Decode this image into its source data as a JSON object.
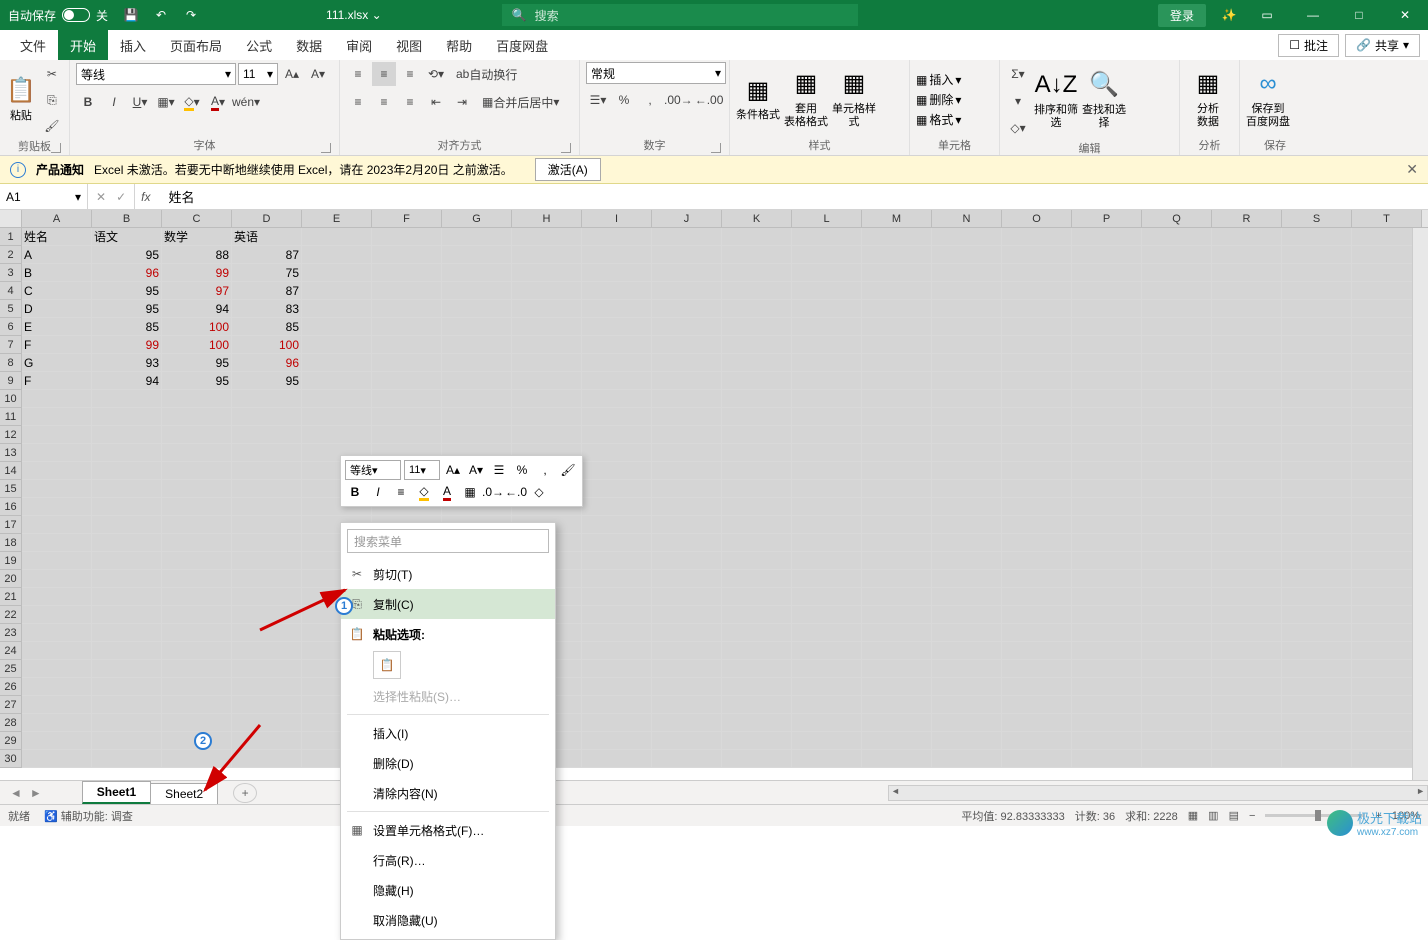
{
  "titlebar": {
    "autosave": "自动保存",
    "autosave_state": "关",
    "filename": "111.xlsx",
    "search_placeholder": "搜索",
    "login": "登录"
  },
  "tabs": {
    "items": [
      "文件",
      "开始",
      "插入",
      "页面布局",
      "公式",
      "数据",
      "审阅",
      "视图",
      "帮助",
      "百度网盘"
    ],
    "selected_index": 1,
    "comment": "批注",
    "share": "共享"
  },
  "ribbon": {
    "clipboard": {
      "label": "剪贴板",
      "paste": "粘贴"
    },
    "font": {
      "label": "字体",
      "name": "等线",
      "size": "11"
    },
    "align": {
      "label": "对齐方式",
      "wrap": "自动换行",
      "merge": "合并后居中"
    },
    "number": {
      "label": "数字",
      "format": "常规"
    },
    "styles": {
      "label": "样式",
      "cond": "条件格式",
      "table": "套用\n表格格式",
      "cell": "单元格样式"
    },
    "cells": {
      "label": "单元格",
      "insert": "插入",
      "delete": "删除",
      "format": "格式"
    },
    "editing": {
      "label": "编辑",
      "sort": "排序和筛选",
      "find": "查找和选择"
    },
    "analysis": {
      "label": "分析",
      "analyze": "分析\n数据"
    },
    "save": {
      "label": "保存",
      "baidu": "保存到\n百度网盘"
    }
  },
  "msgbar": {
    "title": "产品通知",
    "text": "Excel 未激活。若要无中断地继续使用 Excel，请在 2023年2月20日 之前激活。",
    "activate": "激活(A)"
  },
  "namebox": "A1",
  "formula": "姓名",
  "columns": [
    "A",
    "B",
    "C",
    "D",
    "E",
    "F",
    "G",
    "H",
    "I",
    "J",
    "K",
    "L",
    "M",
    "N",
    "O",
    "P",
    "Q",
    "R",
    "S",
    "T"
  ],
  "chart_data": {
    "type": "table",
    "headers": [
      "姓名",
      "语文",
      "数学",
      "英语"
    ],
    "rows": [
      {
        "name": "A",
        "yw": 95,
        "sx": 88,
        "yy": 87,
        "red": []
      },
      {
        "name": "B",
        "yw": 96,
        "sx": 99,
        "yy": 75,
        "red": [
          "yw",
          "sx"
        ]
      },
      {
        "name": "C",
        "yw": 95,
        "sx": 97,
        "yy": 87,
        "red": [
          "sx"
        ]
      },
      {
        "name": "D",
        "yw": 95,
        "sx": 94,
        "yy": 83,
        "red": []
      },
      {
        "name": "E",
        "yw": 85,
        "sx": 100,
        "yy": 85,
        "red": [
          "sx"
        ]
      },
      {
        "name": "F",
        "yw": 99,
        "sx": 100,
        "yy": 100,
        "red": [
          "yw",
          "sx",
          "yy"
        ]
      },
      {
        "name": "G",
        "yw": 93,
        "sx": 95,
        "yy": 96,
        "red": [
          "yy"
        ]
      },
      {
        "name": "F",
        "yw": 94,
        "sx": 95,
        "yy": 95,
        "red": []
      }
    ]
  },
  "mini": {
    "font": "等线",
    "size": "11"
  },
  "ctx": {
    "search": "搜索菜单",
    "cut": "剪切(T)",
    "copy": "复制(C)",
    "paste_opts": "粘贴选项:",
    "paste_special": "选择性粘贴(S)…",
    "insert": "插入(I)",
    "delete": "删除(D)",
    "clear": "清除内容(N)",
    "format_cells": "设置单元格格式(F)…",
    "row_height": "行高(R)…",
    "hide": "隐藏(H)",
    "unhide": "取消隐藏(U)"
  },
  "sheets": {
    "tabs": [
      "Sheet1",
      "Sheet2"
    ],
    "active": 0
  },
  "status": {
    "ready": "就绪",
    "acc": "辅助功能: 调查",
    "avg_label": "平均值:",
    "avg": "92.83333333",
    "count_label": "计数:",
    "count": "36",
    "sum_label": "求和:",
    "sum": "2228",
    "zoom": "100%"
  },
  "watermark": {
    "text1": "极光下载站",
    "text2": "www.xz7.com"
  }
}
